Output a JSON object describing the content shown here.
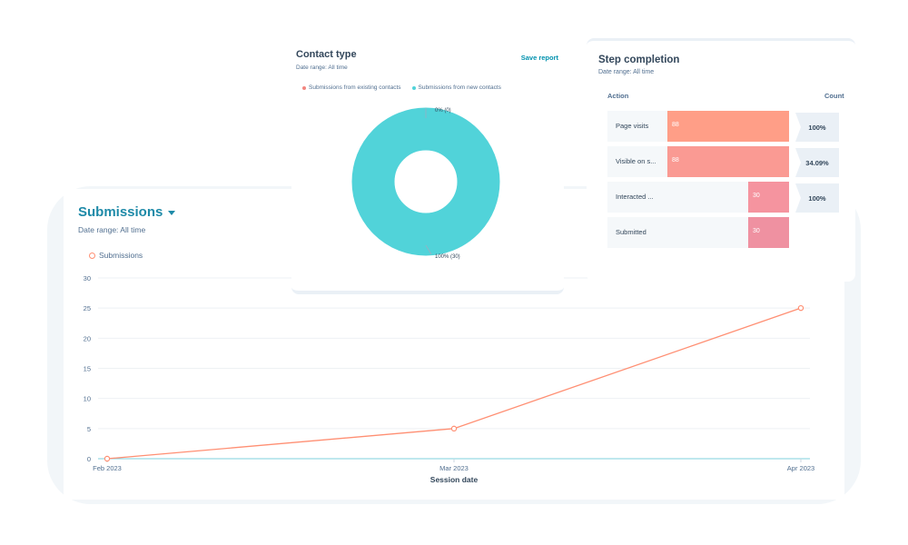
{
  "submissions": {
    "title": "Submissions",
    "date_range": "Date range: All time",
    "legend": "Submissions",
    "x_axis_title": "Session date"
  },
  "contact_type": {
    "title": "Contact type",
    "date_range": "Date range: All time",
    "save_report": "Save report",
    "legend": [
      "Submissions from existing contacts",
      "Submissions from new contacts"
    ],
    "label_existing": "0% (0)",
    "label_new": "100% (30)"
  },
  "step_completion": {
    "title": "Step completion",
    "date_range": "Date range: All time",
    "col_action": "Action",
    "col_count": "Count",
    "rows": [
      {
        "label": "Page visits",
        "value": "88",
        "pct": "100%"
      },
      {
        "label": "Visible on s...",
        "value": "88",
        "pct": "34.09%"
      },
      {
        "label": "Interacted ...",
        "value": "30",
        "pct": "100%"
      },
      {
        "label": "Submitted",
        "value": "30",
        "pct": ""
      }
    ]
  },
  "colors": {
    "accent": "#1e8aa8",
    "line": "#ff8f73",
    "teal": "#51d3d9",
    "existing": "#f2867f"
  },
  "chart_data": [
    {
      "type": "line",
      "title": "Submissions",
      "xlabel": "Session date",
      "ylabel": "",
      "x": [
        "Feb 2023",
        "Mar 2023",
        "Apr 2023"
      ],
      "series": [
        {
          "name": "Submissions",
          "values": [
            0,
            5,
            25
          ]
        }
      ],
      "ylim": [
        0,
        30
      ],
      "yticks": [
        0,
        5,
        10,
        15,
        20,
        25,
        30
      ],
      "grid": true,
      "legend": "top-left"
    },
    {
      "type": "pie",
      "title": "Contact type",
      "categories": [
        "Submissions from existing contacts",
        "Submissions from new contacts"
      ],
      "values": [
        0,
        30
      ],
      "percent": [
        0,
        100
      ],
      "legend": "top"
    },
    {
      "type": "bar",
      "title": "Step completion",
      "categories": [
        "Page visits",
        "Visible on s...",
        "Interacted ...",
        "Submitted"
      ],
      "values": [
        88,
        88,
        30,
        30
      ],
      "conversion": [
        "100%",
        "34.09%",
        "100%"
      ]
    }
  ]
}
